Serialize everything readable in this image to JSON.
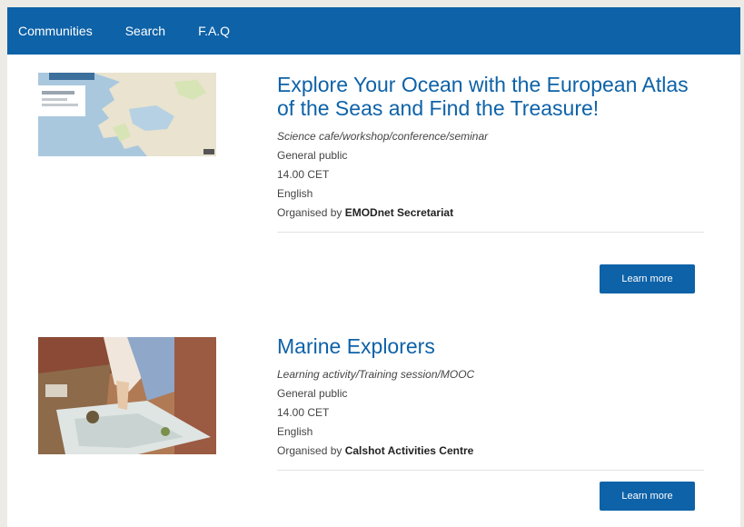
{
  "nav": {
    "items": [
      "Communities",
      "Search",
      "F.A.Q"
    ]
  },
  "events": [
    {
      "title": "Explore Your Ocean with the European Atlas of the Seas and Find the Treasure!",
      "type": "Science cafe/workshop/conference/seminar",
      "audience": "General public",
      "time": "14.00 CET",
      "language": "English",
      "organiser_prefix": "Organised by",
      "organiser": "EMODnet Secretariat",
      "button": "Learn more"
    },
    {
      "title": "Marine Explorers",
      "type": "Learning activity/Training session/MOOC",
      "audience": "General public",
      "time": "14.00 CET",
      "language": "English",
      "organiser_prefix": "Organised by",
      "organiser": "Calshot Activities Centre",
      "button": "Learn more"
    }
  ],
  "colors": {
    "brand": "#0e62a8",
    "page_bg": "#ecebe6",
    "content_bg": "#ffffff"
  },
  "icons": {
    "event1_image": "map-thumbnail",
    "event2_image": "photo-thumbnail"
  }
}
